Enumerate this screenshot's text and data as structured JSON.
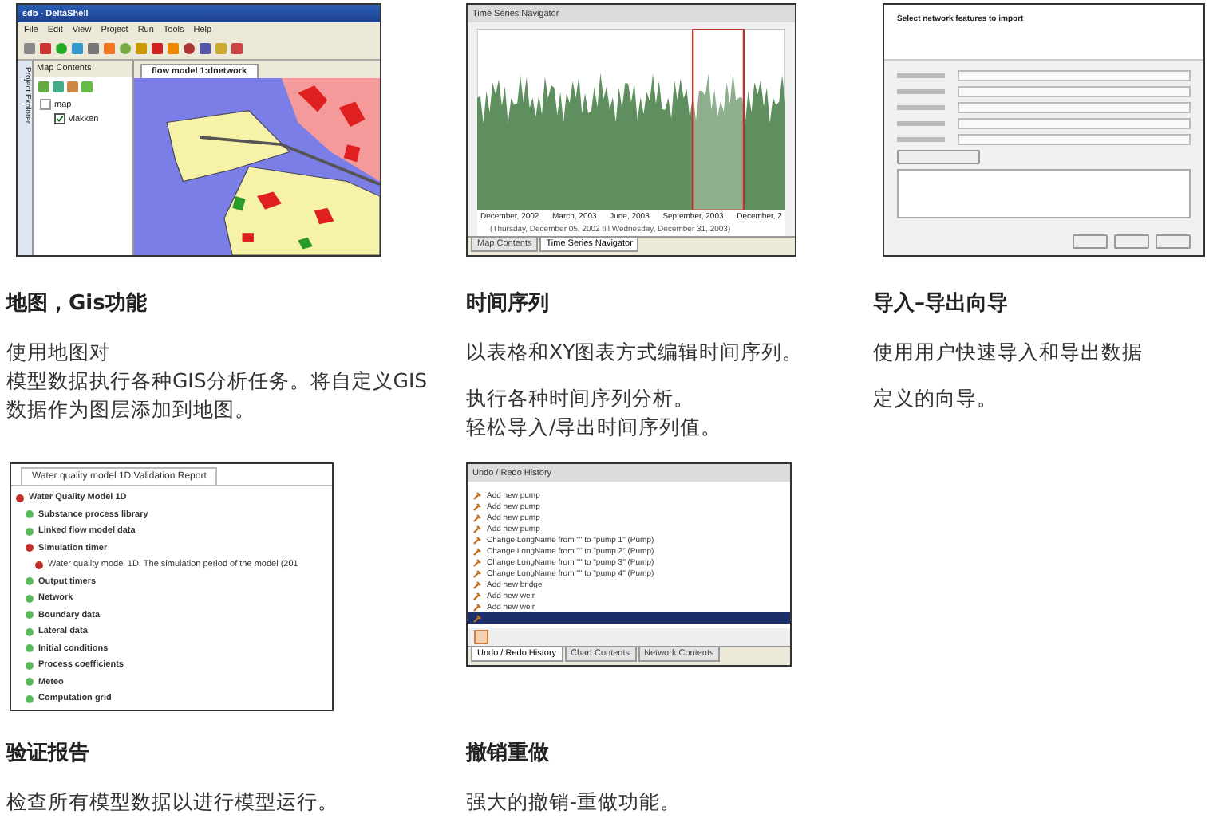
{
  "features": [
    {
      "kind": "map",
      "title": "地图，Gis功能",
      "paragraphs": [
        [
          "使用地图对",
          "模型数据执行各种GIS分析任务。将自定义GIS",
          "数据作为图层添加到地图。"
        ]
      ],
      "screenshot": {
        "window_title": "sdb - DeltaShell",
        "menu": [
          "File",
          "Edit",
          "View",
          "Project",
          "Run",
          "Tools",
          "Help"
        ],
        "side_tab": "Project Explorer",
        "panel_title": "Map Contents",
        "tree": [
          {
            "label": "map",
            "expanded": true,
            "children": [
              {
                "label": "vlakken",
                "checked": true
              }
            ]
          }
        ],
        "document_tab": "flow model 1:dnetwork"
      }
    },
    {
      "kind": "timeseries",
      "title": "时间序列",
      "paragraphs": [
        [
          "以表格和XY图表方式编辑时间序列。"
        ],
        [
          "执行各种时间序列分析。",
          "轻松导入/导出时间序列值。"
        ]
      ],
      "screenshot": {
        "window_title": "Time Series Navigator",
        "axis_labels": [
          "December, 2002",
          "March, 2003",
          "June, 2003",
          "September, 2003",
          "December, 2"
        ],
        "range_text": "(Thursday, December 05, 2002 till Wednesday, December 31, 2003)",
        "tabs": [
          {
            "label": "Map Contents",
            "selected": false
          },
          {
            "label": "Time Series Navigator",
            "selected": true
          }
        ]
      }
    },
    {
      "kind": "wizard",
      "title": "导入–导出向导",
      "paragraphs": [
        [
          "使用用户快速导入和导出数据"
        ],
        [
          "定义的向导。"
        ]
      ],
      "screenshot": {
        "heading": "Select network features to import"
      }
    },
    {
      "kind": "validation",
      "title": "验证报告",
      "paragraphs": [
        [
          "检查所有模型数据以进行模型运行。"
        ]
      ],
      "screenshot": {
        "tab": "Water quality model 1D Validation Report",
        "tree": [
          {
            "label": "Water Quality Model 1D",
            "kind": "error",
            "children": [
              {
                "label": "Substance process library",
                "kind": "ok"
              },
              {
                "label": "Linked flow model data",
                "kind": "ok"
              },
              {
                "label": "Simulation timer",
                "kind": "error",
                "children": [
                  {
                    "label": "Water quality model 1D: The simulation period of the model (201",
                    "kind": "error"
                  }
                ]
              },
              {
                "label": "Output timers",
                "kind": "ok"
              },
              {
                "label": "Network",
                "kind": "ok"
              },
              {
                "label": "Boundary data",
                "kind": "ok"
              },
              {
                "label": "Lateral data",
                "kind": "ok"
              },
              {
                "label": "Initial conditions",
                "kind": "ok"
              },
              {
                "label": "Process coefficients",
                "kind": "ok"
              },
              {
                "label": "Meteo",
                "kind": "ok"
              },
              {
                "label": "Computation grid",
                "kind": "ok"
              }
            ]
          }
        ]
      }
    },
    {
      "kind": "undo",
      "title": "撤销重做",
      "paragraphs": [
        [
          "强大的撤销-重做功能。"
        ]
      ],
      "screenshot": {
        "window_title": "Undo / Redo History",
        "items": [
          {
            "label": "Add new pump",
            "selected": false
          },
          {
            "label": "Add new pump",
            "selected": false
          },
          {
            "label": "Add new pump",
            "selected": false
          },
          {
            "label": "Add new pump",
            "selected": false
          },
          {
            "label": "Change LongName from \"\" to \"pump 1\" (Pump)",
            "selected": false
          },
          {
            "label": "Change LongName from \"\" to \"pump 2\" (Pump)",
            "selected": false
          },
          {
            "label": "Change LongName from \"\" to \"pump 3\" (Pump)",
            "selected": false
          },
          {
            "label": "Change LongName from \"\" to \"pump 4\" (Pump)",
            "selected": false
          },
          {
            "label": "Add new bridge",
            "selected": false
          },
          {
            "label": "Add new weir",
            "selected": false
          },
          {
            "label": "Add new weir",
            "selected": false
          },
          {
            "selected": true
          }
        ],
        "tabs": [
          {
            "label": "Undo / Redo History",
            "selected": true
          },
          {
            "label": "Chart Contents",
            "selected": false
          },
          {
            "label": "Network Contents",
            "selected": false
          }
        ]
      }
    }
  ]
}
